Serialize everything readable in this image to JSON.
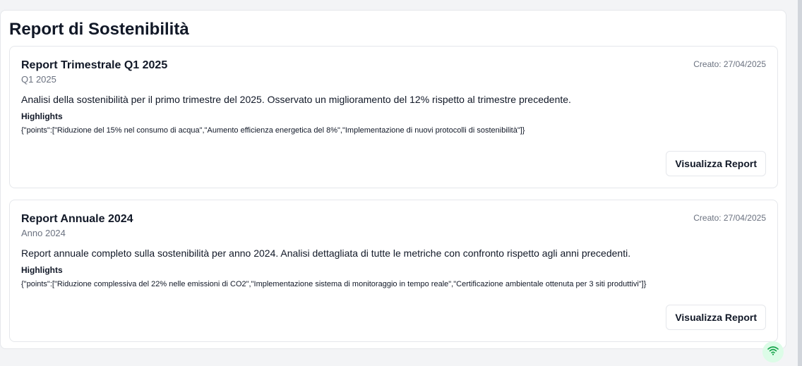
{
  "page": {
    "title": "Report di Sostenibilità"
  },
  "reports": [
    {
      "title": "Report Trimestrale Q1 2025",
      "period": "Q1 2025",
      "created": "Creato: 27/04/2025",
      "description": "Analisi della sostenibilità per il primo trimestre del 2025. Osservato un miglioramento del 12% rispetto al trimestre precedente.",
      "highlights_label": "Highlights",
      "highlights_value": "{\"points\":[\"Riduzione del 15% nel consumo di acqua\",\"Aumento efficienza energetica del 8%\",\"Implementazione di nuovi protocolli di sostenibilità\"]}",
      "button_label": "Visualizza Report"
    },
    {
      "title": "Report Annuale 2024",
      "period": "Anno 2024",
      "created": "Creato: 27/04/2025",
      "description": "Report annuale completo sulla sostenibilità per anno 2024. Analisi dettagliata di tutte le metriche con confronto rispetto agli anni precedenti.",
      "highlights_label": "Highlights",
      "highlights_value": "{\"points\":[\"Riduzione complessiva del 22% nelle emissioni di CO2\",\"Implementazione sistema di monitoraggio in tempo reale\",\"Certificazione ambientale ottenuta per 3 siti produttivi\"]}",
      "button_label": "Visualizza Report"
    }
  ],
  "status": {
    "icon": "wifi-icon",
    "color": "#16a34a"
  }
}
